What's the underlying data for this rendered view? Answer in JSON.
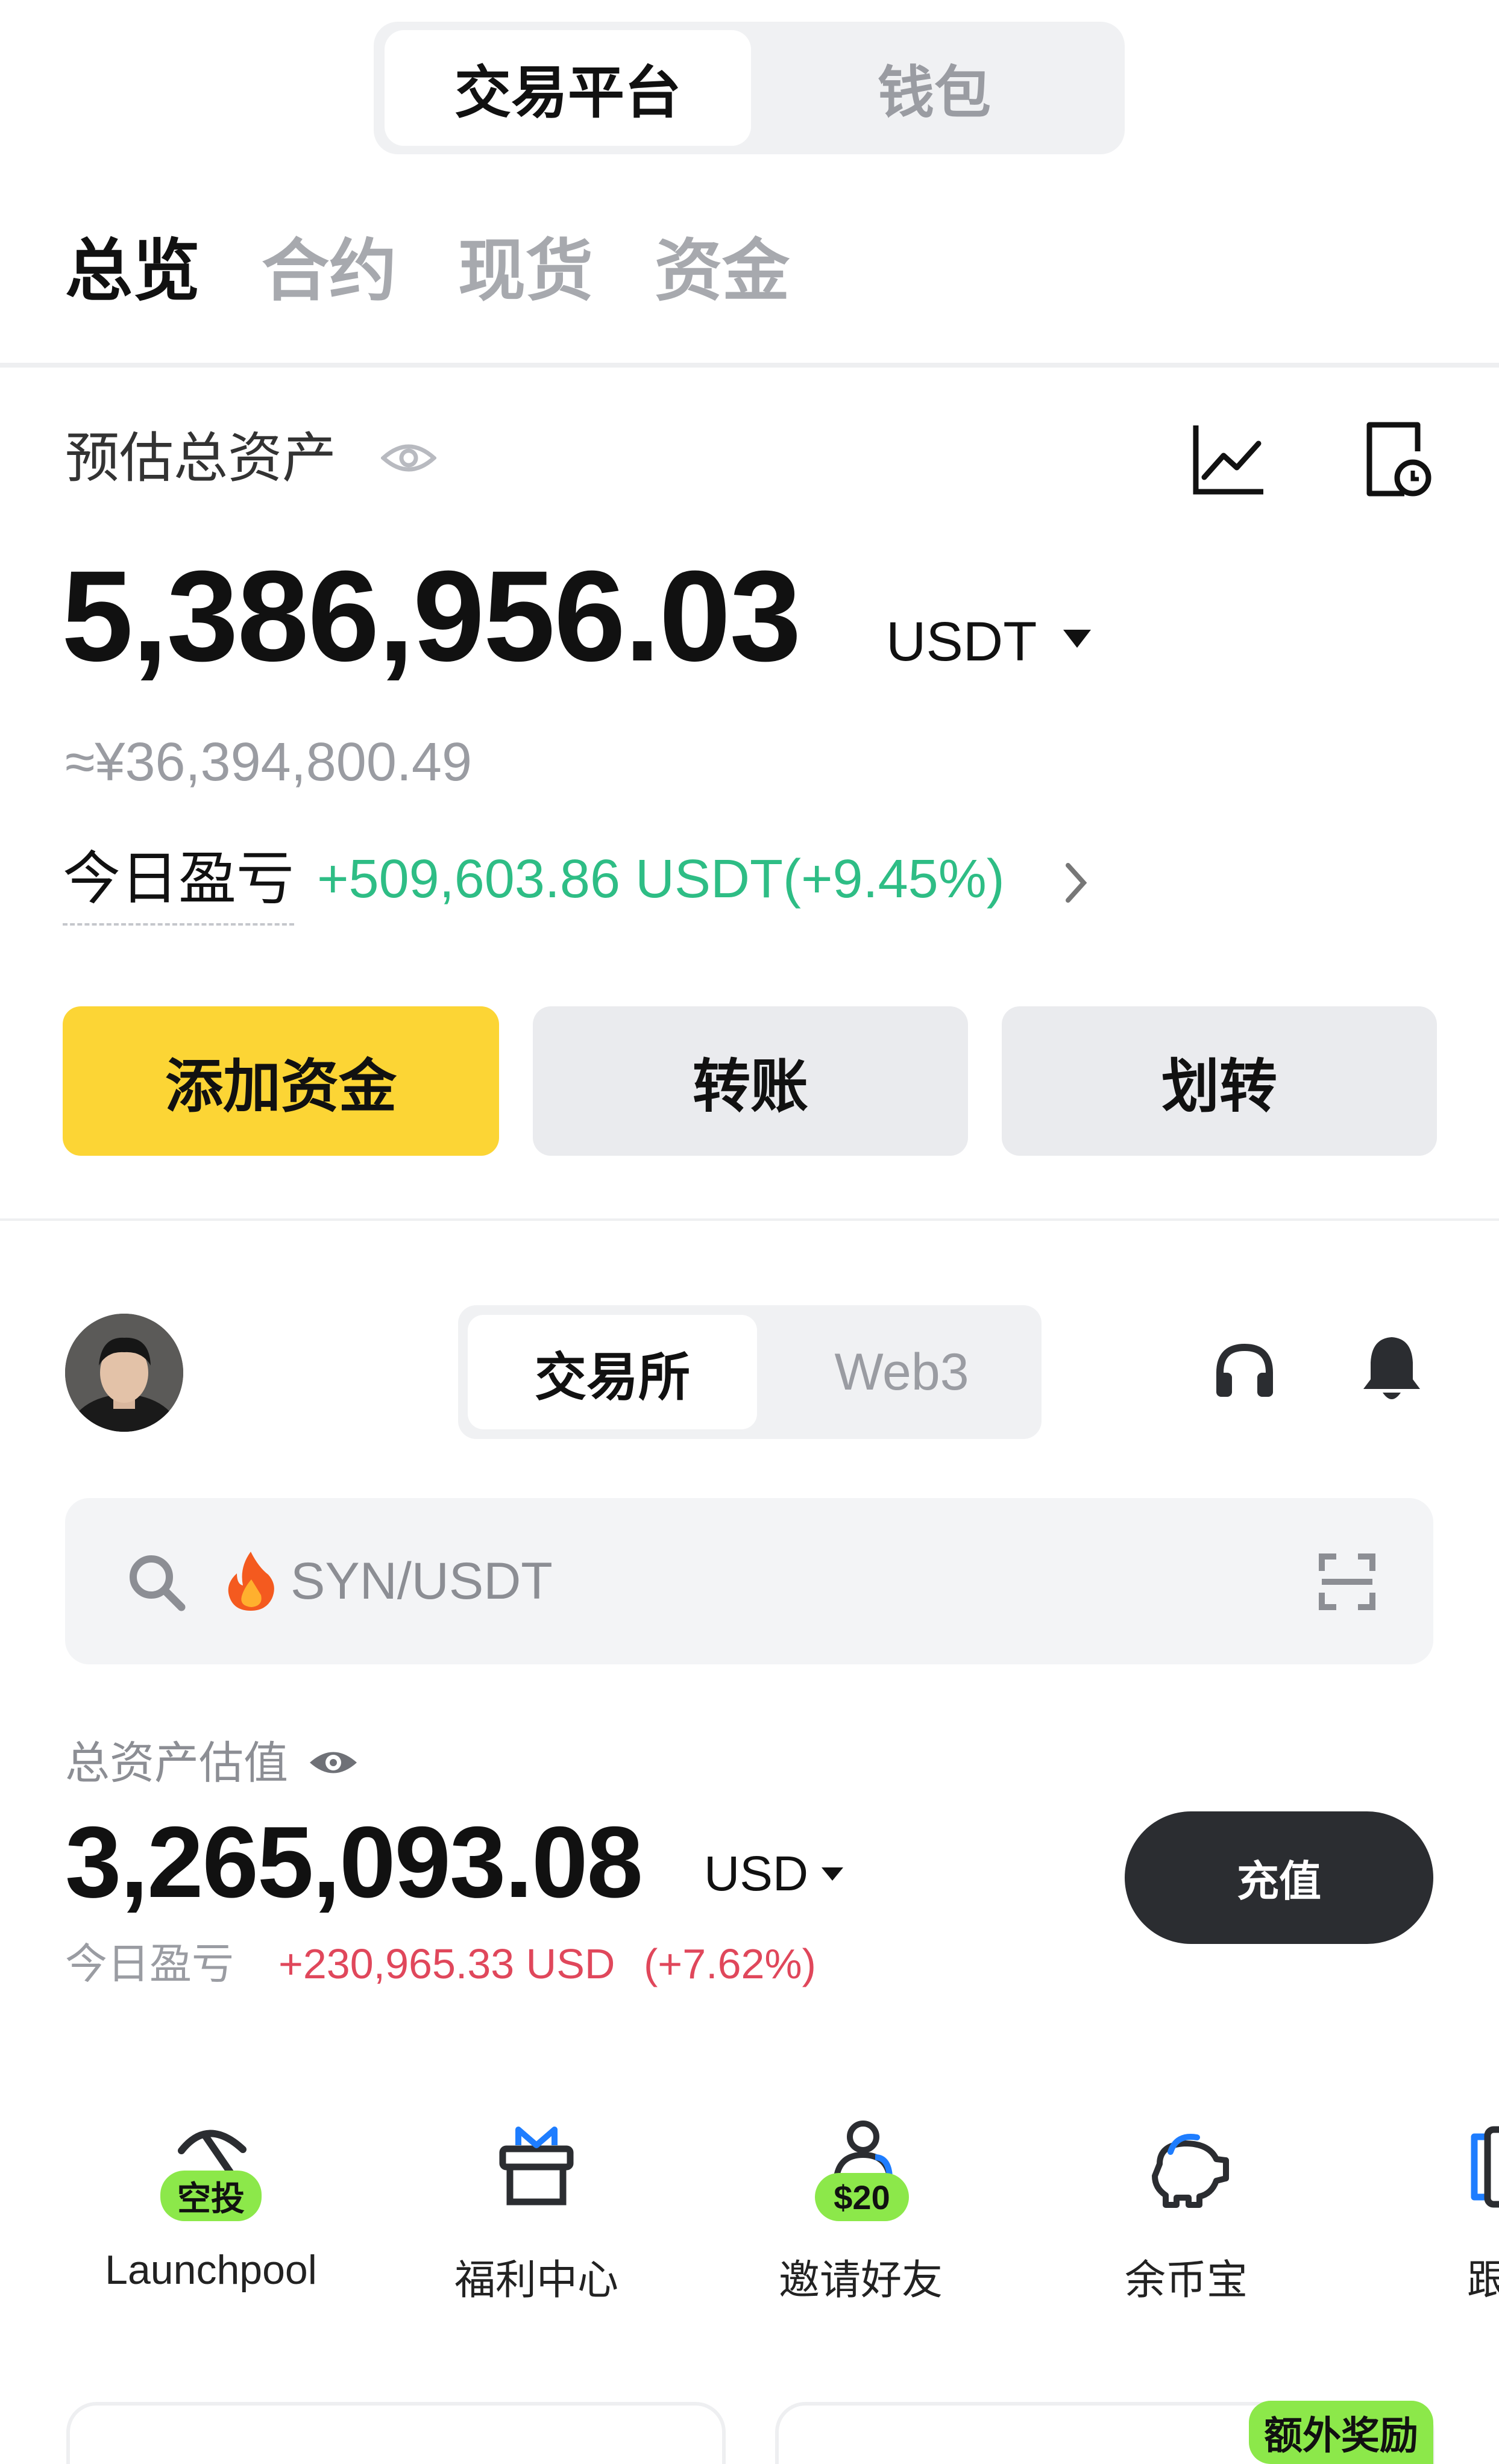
{
  "top_switch": {
    "active": "交易平台",
    "inactive": "钱包"
  },
  "tabs": [
    {
      "label": "总览",
      "active": true
    },
    {
      "label": "合约",
      "active": false
    },
    {
      "label": "现货",
      "active": false
    },
    {
      "label": "资金",
      "active": false
    }
  ],
  "overview": {
    "title": "预估总资产",
    "total_value": "5,386,956.03",
    "currency": "USDT",
    "cny_value": "≈¥36,394,800.49",
    "pnl_label": "今日盈亏",
    "pnl_value": "+509,603.86 USDT(+9.45%)",
    "buttons": {
      "add_funds": "添加资金",
      "transfer": "转账",
      "move": "划转"
    }
  },
  "exchange": {
    "switch": {
      "active": "交易所",
      "inactive": "Web3"
    },
    "search_placeholder": "SYN/USDT",
    "assets_label": "总资产估值",
    "total_value": "3,265,093.08",
    "currency": "USD",
    "pnl_label": "今日盈亏",
    "pnl_value": "+230,965.33 USD",
    "pnl_pct": "(+7.62%)",
    "deposit_label": "充值"
  },
  "shortcuts": [
    {
      "label": "Launchpool",
      "badge": "空投",
      "icon": "pickaxe-icon"
    },
    {
      "label": "福利中心",
      "icon": "gift-icon"
    },
    {
      "label": "邀请好友",
      "badge": "$20",
      "icon": "invite-user-icon"
    },
    {
      "label": "余币宝",
      "icon": "piggy-bank-icon"
    },
    {
      "label": "跟",
      "icon": "copy-trade-icon"
    }
  ],
  "card_badge": "额外奖励",
  "colors": {
    "accent_yellow": "#fcd535",
    "green": "#2ebd85",
    "red": "#e0475b",
    "dark_button": "#2b2d31",
    "gray_text": "#9a9ca2"
  }
}
